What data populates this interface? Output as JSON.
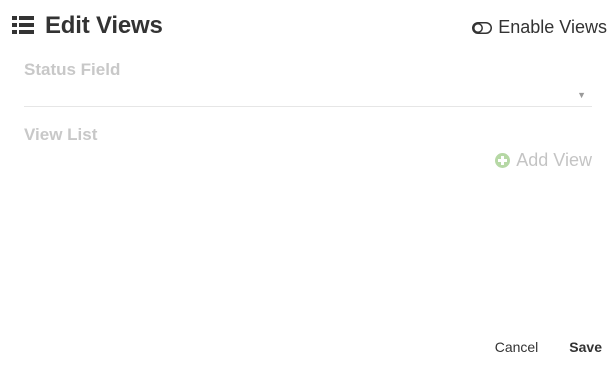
{
  "header": {
    "title": "Edit Views",
    "title_icon": "list-icon",
    "enable_views": {
      "label": "Enable Views",
      "icon": "toggle-off-icon",
      "enabled": false
    }
  },
  "status_field": {
    "label": "Status Field",
    "value": "",
    "icon": "caret-down-icon"
  },
  "view_list": {
    "label": "View List",
    "add_label": "Add View",
    "add_icon": "plus-circle-icon",
    "items": []
  },
  "footer": {
    "cancel_label": "Cancel",
    "save_label": "Save"
  },
  "colors": {
    "text": "#333333",
    "muted_label": "#c8c8c8",
    "add_icon": "#b6d8a5",
    "divider": "#e6e6e6"
  }
}
